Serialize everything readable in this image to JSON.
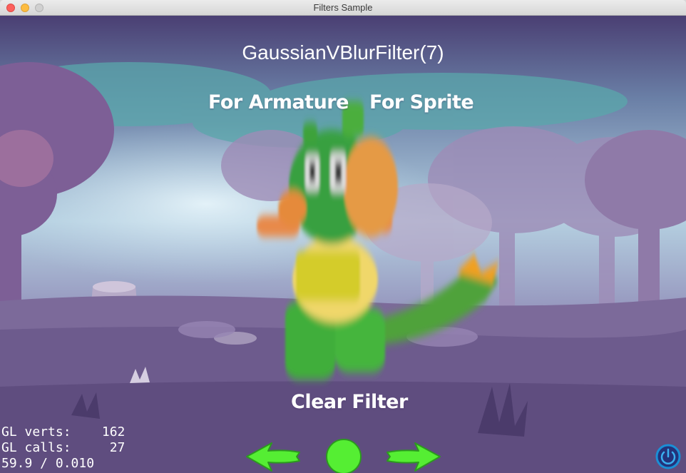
{
  "window": {
    "title": "Filters Sample"
  },
  "scene": {
    "filter_name": "GaussianVBlurFilter(7)",
    "buttons": {
      "for_armature": "For Armature",
      "for_sprite": "For Sprite",
      "clear_filter": "Clear Filter"
    },
    "character": "dragon-armature"
  },
  "stats": {
    "gl_verts": "GL verts:    162",
    "gl_calls": "GL calls:     27",
    "fps": "59.9 / 0.010"
  },
  "navigation": {
    "prev_icon": "left-arrow-icon",
    "restart_icon": "circle-restart-icon",
    "next_icon": "right-arrow-icon",
    "power_icon": "power-icon"
  },
  "colors": {
    "nav_green": "#55ee33",
    "text": "#ffffff",
    "power_blue": "#1a8fd6"
  }
}
